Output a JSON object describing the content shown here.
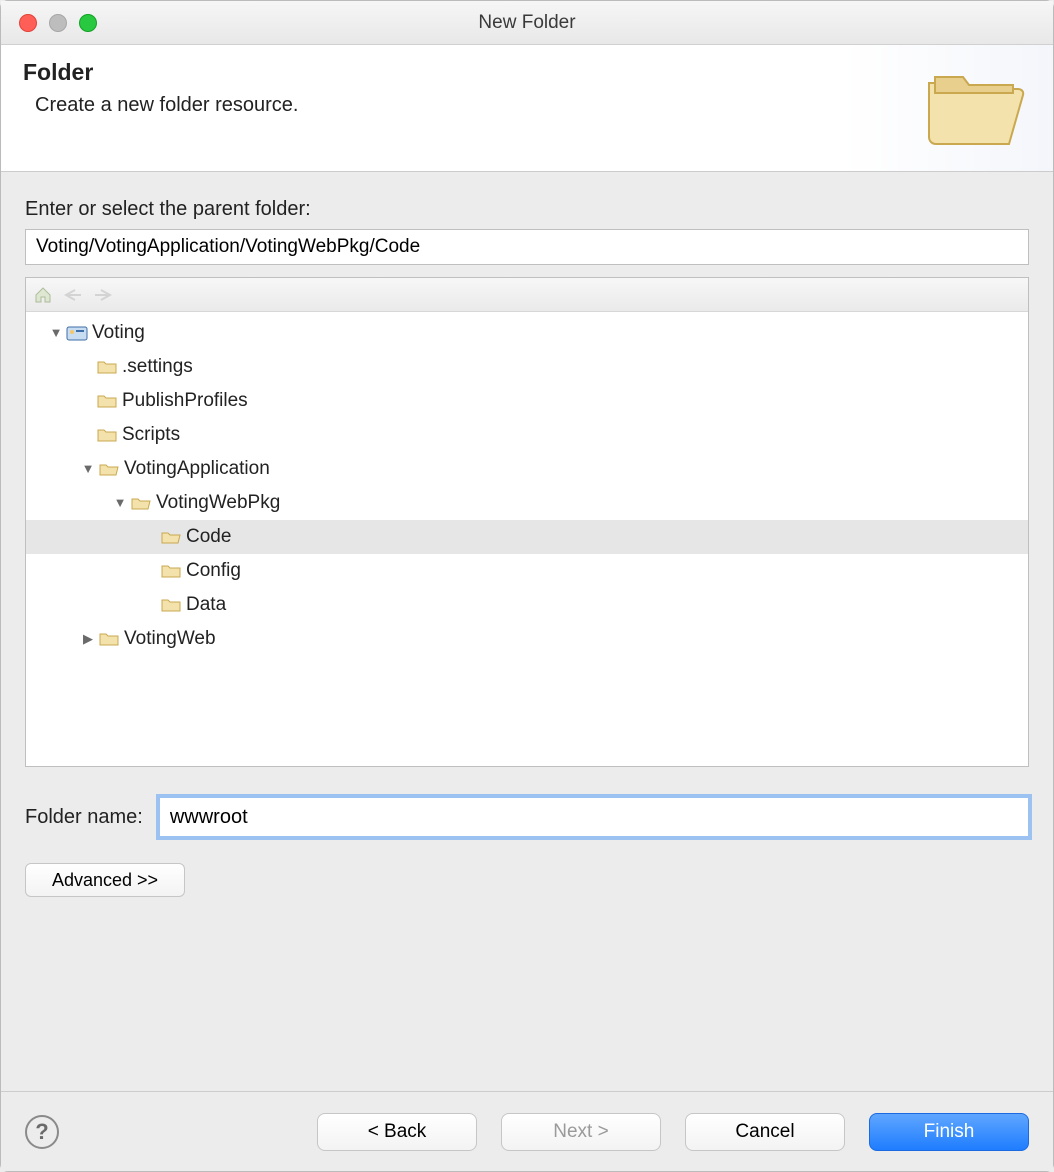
{
  "window": {
    "title": "New Folder"
  },
  "header": {
    "title": "Folder",
    "subtitle": "Create a new folder resource."
  },
  "parent_label": "Enter or select the parent folder:",
  "parent_path": "Voting/VotingApplication/VotingWebPkg/Code",
  "tree": {
    "root": "Voting",
    "items": {
      "settings": ".settings",
      "publish": "PublishProfiles",
      "scripts": "Scripts",
      "votingapp": "VotingApplication",
      "votingwebpkg": "VotingWebPkg",
      "code": "Code",
      "config": "Config",
      "data": "Data",
      "votingweb": "VotingWeb"
    }
  },
  "folder_name_label": "Folder name:",
  "folder_name_value": "wwwroot",
  "advanced_label": "Advanced >>",
  "buttons": {
    "back": "< Back",
    "next": "Next >",
    "cancel": "Cancel",
    "finish": "Finish"
  }
}
